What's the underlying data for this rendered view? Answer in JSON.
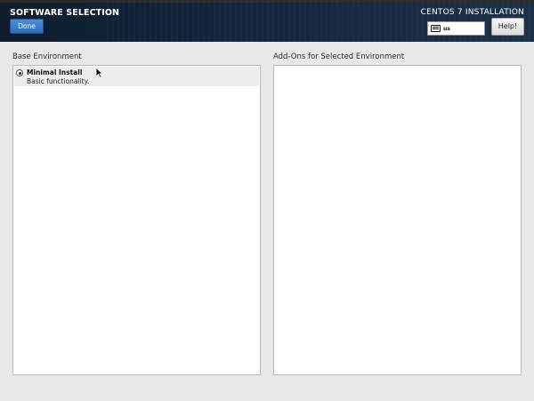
{
  "header": {
    "title": "SOFTWARE SELECTION",
    "done_label": "Done",
    "product_title": "CENTOS 7 INSTALLATION",
    "keyboard_layout": "us",
    "help_label": "Help!"
  },
  "base_environment": {
    "label": "Base Environment",
    "items": [
      {
        "name": "Minimal Install",
        "description": "Basic functionality.",
        "selected": true
      }
    ]
  },
  "addons": {
    "label": "Add-Ons for Selected Environment",
    "items": []
  }
}
